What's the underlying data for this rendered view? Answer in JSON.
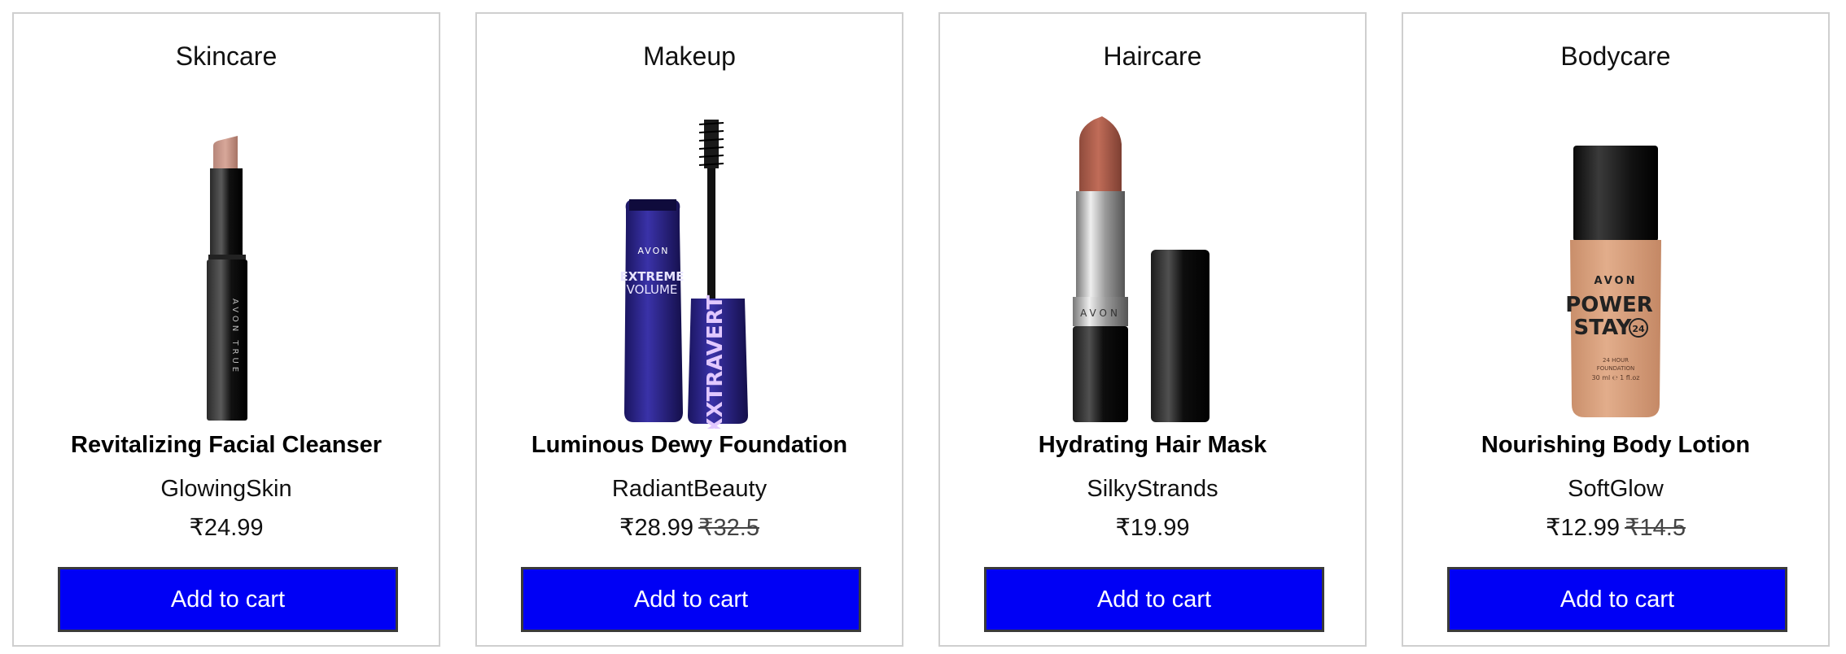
{
  "currency_symbol": "₹",
  "colors": {
    "button_bg": "#0000f5",
    "button_text": "#ffffff",
    "card_border": "#cfcfcf"
  },
  "products": [
    {
      "category": "Skincare",
      "image_icon": "slim-lipstick-icon",
      "name": "Revitalizing Facial Cleanser",
      "brand": "GlowingSkin",
      "price": "₹24.99",
      "old_price": "",
      "button_label": "Add to cart"
    },
    {
      "category": "Makeup",
      "image_icon": "mascara-icon",
      "name": "Luminous Dewy Foundation",
      "brand": "RadiantBeauty",
      "price": "₹28.99",
      "old_price": "₹32.5",
      "button_label": "Add to cart"
    },
    {
      "category": "Haircare",
      "image_icon": "lipstick-icon",
      "name": "Hydrating Hair Mask",
      "brand": "SilkyStrands",
      "price": "₹19.99",
      "old_price": "",
      "button_label": "Add to cart"
    },
    {
      "category": "Bodycare",
      "image_icon": "foundation-bottle-icon",
      "name": "Nourishing Body Lotion",
      "brand": "SoftGlow",
      "price": "₹12.99",
      "old_price": "₹14.5",
      "button_label": "Add to cart"
    }
  ],
  "image_labels": {
    "slim_lipstick": "AVON TRUE",
    "mascara_brand": "AVON",
    "mascara_line1": "EXTREME",
    "mascara_line2": "VOLUME",
    "mascara_brush": "EXXTRAVERT",
    "lipstick_brand": "AVON",
    "foundation_brand": "AVON",
    "foundation_line1": "POWER",
    "foundation_line2": "STAY",
    "foundation_badge": "24",
    "foundation_small1": "24 HOUR",
    "foundation_small2": "FOUNDATION",
    "foundation_small3": "30 ml ℮ 1 fl.oz"
  }
}
